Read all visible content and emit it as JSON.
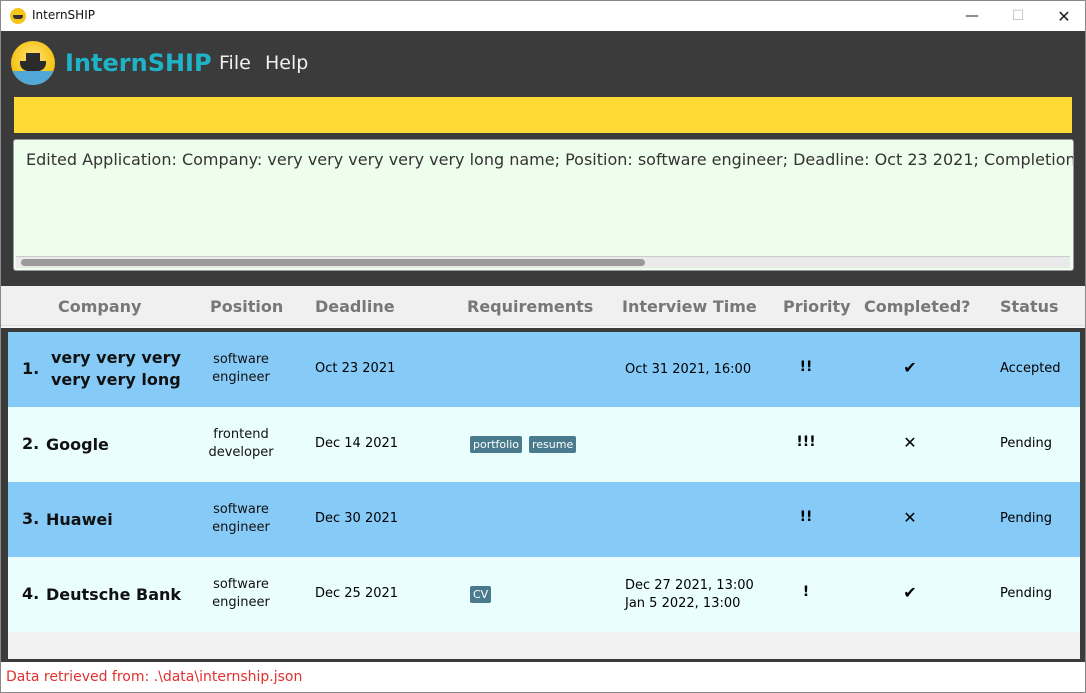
{
  "window": {
    "title": "InternSHIP",
    "min_symbol": "—",
    "max_symbol": "☐",
    "close_symbol": "✕"
  },
  "menubar": {
    "brand": "InternSHIP",
    "file_label": "File",
    "help_label": "Help"
  },
  "command_box": {
    "value": ""
  },
  "result_box": {
    "text": "Edited Application: Company: very very very very very long name; Position: software engineer; Deadline: Oct 23 2021; Completion: Completed; Status: Accepted"
  },
  "table": {
    "headers": [
      "Company",
      "Position",
      "Deadline",
      "Requirements",
      "Interview Time",
      "Priority",
      "Completed?",
      "Status"
    ],
    "rows": [
      {
        "index": "1.",
        "company_line1": "very very very",
        "company_line2": "very very long",
        "position_line1": "software",
        "position_line2": "engineer",
        "deadline": "Oct 23 2021",
        "interview_line1": "Oct 31 2021, 16:00",
        "interview_line2": "",
        "priority": "!!",
        "completed": "✔",
        "status": "Accepted"
      },
      {
        "index": "2.",
        "company": "Google",
        "position_line1": "frontend",
        "position_line2": "developer",
        "deadline": "Dec 14 2021",
        "tags": [
          "portfolio",
          "resume"
        ],
        "priority": "!!!",
        "completed": "✕",
        "status": "Pending"
      },
      {
        "index": "3.",
        "company": "Huawei",
        "position_line1": "software",
        "position_line2": "engineer",
        "deadline": "Dec 30 2021",
        "priority": "!!",
        "completed": "✕",
        "status": "Pending"
      },
      {
        "index": "4.",
        "company": "Deutsche Bank",
        "position_line1": "software",
        "position_line2": "engineer",
        "deadline": "Dec 25 2021",
        "tags": [
          "CV"
        ],
        "interview_line1": "Dec 27 2021, 13:00",
        "interview_line2": "Jan 5 2022, 13:00",
        "priority": "!",
        "completed": "✔",
        "status": "Pending"
      }
    ]
  },
  "statusbar": {
    "text": "Data retrieved from:  .\\data\\internship.json"
  },
  "colors": {
    "accent": "#1fb3c8",
    "command_bg": "#ffd934",
    "row_selected": "#86cbf8",
    "row_alt": "#eafefe",
    "status_text": "#e03030"
  }
}
